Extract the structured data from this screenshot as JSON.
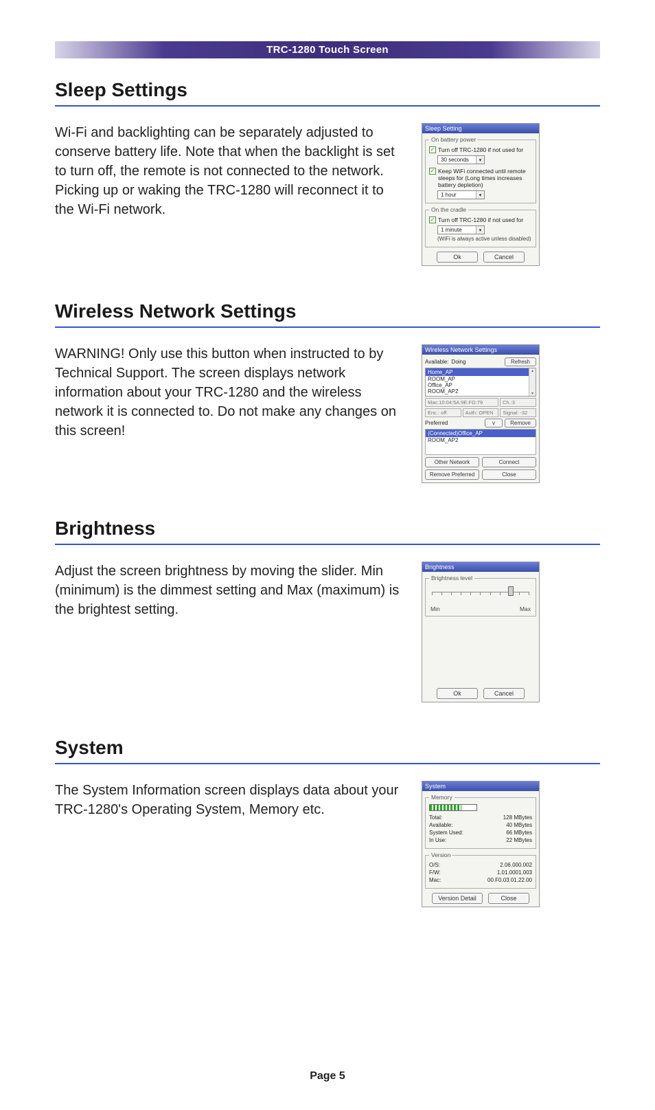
{
  "header": {
    "title": "TRC-1280 Touch Screen"
  },
  "footer": {
    "page_label": "Page 5"
  },
  "sections": {
    "sleep": {
      "heading": "Sleep Settings",
      "body": "Wi-Fi and backlighting can be separately adjusted to conserve battery life. Note that when the backlight is set to turn off, the remote is not connected to the network. Picking up or waking the TRC-1280 will reconnect it to the Wi-Fi network."
    },
    "wireless": {
      "heading": "Wireless Network Settings",
      "body": "WARNING! Only use this button when instructed to by Technical Support. The screen displays network information about your TRC-1280 and the wireless network it is connected to. Do not make any changes on this screen!"
    },
    "brightness": {
      "heading": "Brightness",
      "body": "Adjust the screen brightness by moving the slider. Min (minimum) is the dimmest setting and Max (maximum) is the brightest setting."
    },
    "system": {
      "heading": "System",
      "body": "The System Information screen displays data about your TRC-1280's Operating System, Memory etc."
    }
  },
  "sleep_panel": {
    "title": "Sleep Setting",
    "group_battery": "On battery power",
    "chk1": "Turn off TRC-1280 if not used for",
    "dd1": "30 seconds",
    "chk2": "Keep WiFi connected until remote sleeps for (Long times increases battery depletion)",
    "dd2": "1 hour",
    "group_cradle": "On the cradle",
    "chk3": "Turn off TRC-1280 if not used for",
    "dd3": "1 minute",
    "note": "(WiFi is always active unless disabled)",
    "ok": "Ok",
    "cancel": "Cancel"
  },
  "wireless_panel": {
    "title": "Wireless Network Settings",
    "available_lbl": "Available:",
    "available_status": "Doing",
    "refresh": "Refresh",
    "list_header": "Home_AP",
    "list_rows": [
      "ROOM_AP",
      "Office_AP",
      "ROOM_AP2"
    ],
    "mac": "Mac:10:04:5A:9E:FD:79",
    "ch": "Ch.:3",
    "enc": "Enc.: off",
    "auth": "Auth: OPEN",
    "signal": "Signal: -32",
    "preferred_lbl": "Preferred",
    "down_btn": "v",
    "remove": "Remove",
    "pref_header": "(Connected)Office_AP",
    "pref_row": "ROOM_AP2",
    "other_network": "Other Network",
    "connect": "Connect",
    "remove_preferred": "Remove Preferred",
    "close": "Close"
  },
  "brightness_panel": {
    "title": "Brightness",
    "group": "Brightness level",
    "min": "Min",
    "max": "Max",
    "ok": "Ok",
    "cancel": "Cancel"
  },
  "system_panel": {
    "title": "System",
    "memory_group": "Memory",
    "total_lbl": "Total:",
    "total_val": "128",
    "total_unit": "MBytes",
    "avail_lbl": "Available:",
    "avail_val": "40",
    "avail_unit": "MBytes",
    "sysused_lbl": "System Used:",
    "sysused_val": "66",
    "sysused_unit": "MBytes",
    "inuse_lbl": "In Use:",
    "inuse_val": "22",
    "inuse_unit": "MBytes",
    "version_group": "Version",
    "os_lbl": "O/S:",
    "os_val": "2.06.000.002",
    "fw_lbl": "F/W:",
    "fw_val": "1.01.0001.003",
    "mac_lbl": "Mac:",
    "mac_val": "00.F0.03.01.22.00",
    "version_detail": "Version Detail",
    "close": "Close"
  }
}
